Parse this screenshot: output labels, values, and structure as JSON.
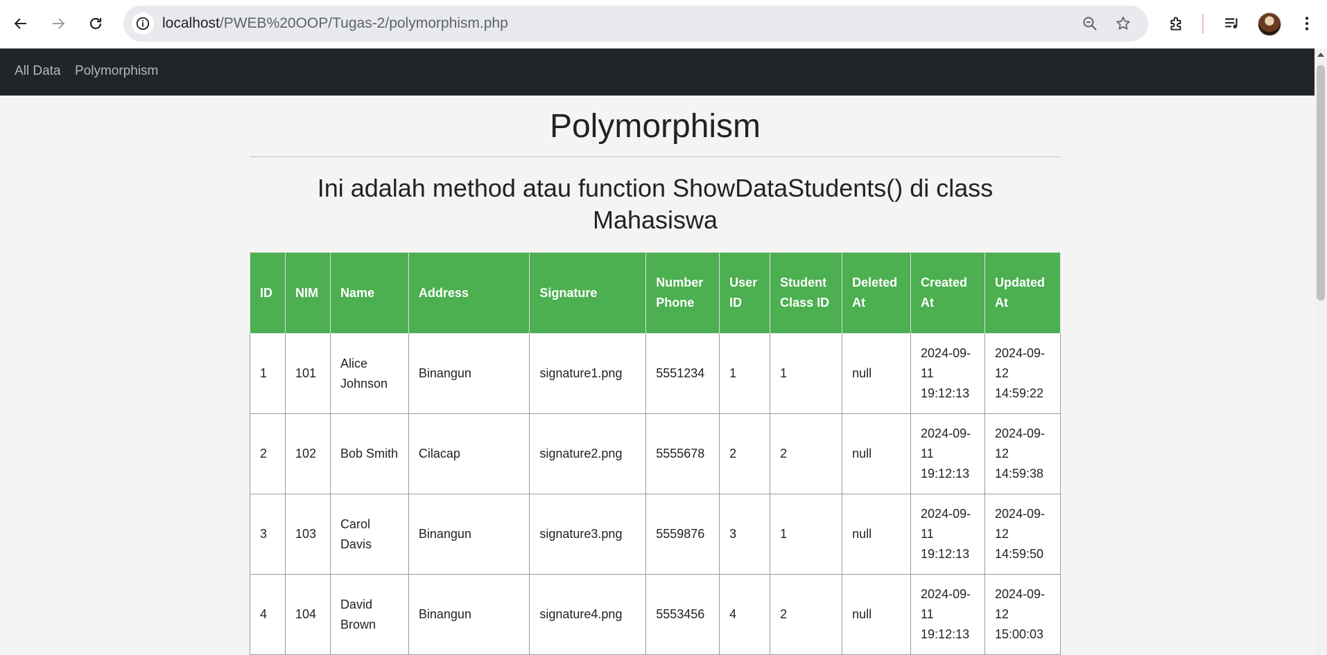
{
  "browser": {
    "url_host": "localhost",
    "url_path": "/PWEB%20OOP/Tugas-2/polymorphism.php"
  },
  "site_nav": {
    "items": [
      {
        "label": "All Data"
      },
      {
        "label": "Polymorphism"
      }
    ]
  },
  "page": {
    "title": "Polymorphism",
    "subtitle": "Ini adalah method atau function ShowDataStudents() di class Mahasiswa"
  },
  "table": {
    "header_color": "#4caf50",
    "columns": [
      "ID",
      "NIM",
      "Name",
      "Address",
      "Signature",
      "Number Phone",
      "User ID",
      "Student Class ID",
      "Deleted At",
      "Created At",
      "Updated At"
    ],
    "rows": [
      [
        "1",
        "101",
        "Alice Johnson",
        "Binangun",
        "signature1.png",
        "5551234",
        "1",
        "1",
        "null",
        "2024-09-11 19:12:13",
        "2024-09-12 14:59:22"
      ],
      [
        "2",
        "102",
        "Bob Smith",
        "Cilacap",
        "signature2.png",
        "5555678",
        "2",
        "2",
        "null",
        "2024-09-11 19:12:13",
        "2024-09-12 14:59:38"
      ],
      [
        "3",
        "103",
        "Carol Davis",
        "Binangun",
        "signature3.png",
        "5559876",
        "3",
        "1",
        "null",
        "2024-09-11 19:12:13",
        "2024-09-12 14:59:50"
      ],
      [
        "4",
        "104",
        "David Brown",
        "Binangun",
        "signature4.png",
        "5553456",
        "4",
        "2",
        "null",
        "2024-09-11 19:12:13",
        "2024-09-12 15:00:03"
      ]
    ]
  }
}
